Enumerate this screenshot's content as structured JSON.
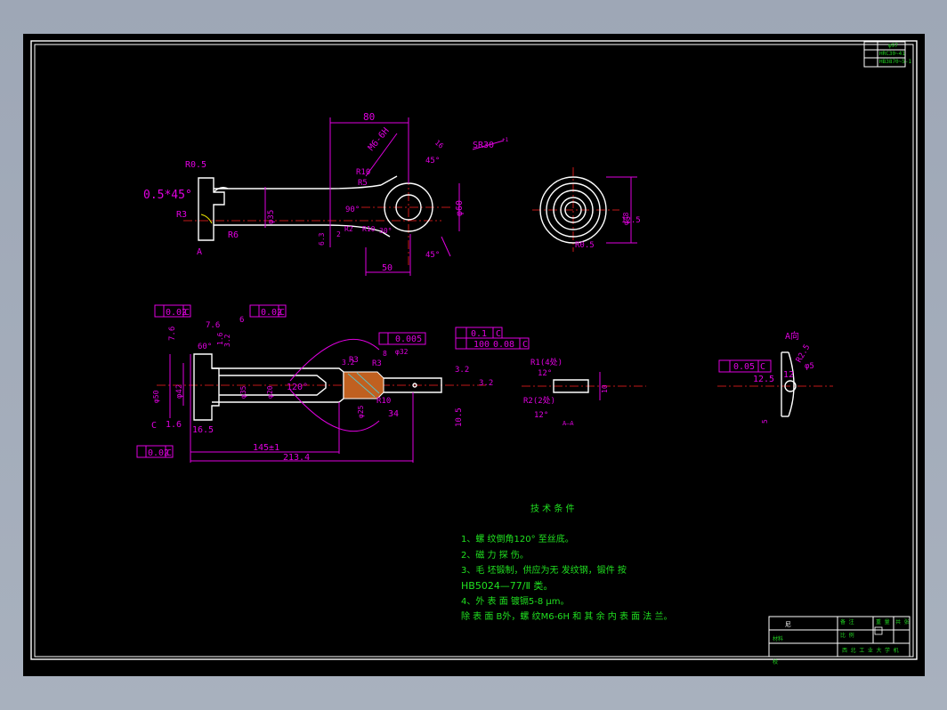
{
  "drawing": {
    "top_view": {
      "dims": [
        "80",
        "M6-6H",
        "SR30",
        "+1",
        "R0.5",
        "0.5*45°",
        "R3",
        "R6",
        "A",
        "R10",
        "R5",
        "90°",
        "R10",
        "2",
        "6.3",
        "R2",
        "30°",
        "50",
        "45°",
        "45°",
        "16",
        "φ60",
        "φ35"
      ]
    },
    "side_view": {
      "dims": [
        "φ48",
        "12.5",
        "R0.5"
      ]
    },
    "section_view": {
      "dims": [
        "0.02",
        "C",
        "7.6",
        "6",
        "0.02",
        "C",
        "7.6",
        "60°",
        "1.6",
        "3.2",
        "φ50",
        "φ42",
        "φ35",
        "φ20",
        "120°",
        "3.2",
        "R3",
        "R3",
        "8",
        "φ25",
        "R10",
        "34",
        "φ32",
        "0.005",
        "0.1",
        "C",
        "100",
        "0.08",
        "C",
        "3.2",
        "10.5",
        "3.2",
        "1.6",
        "16.5",
        "145±1",
        "213.4",
        "0.02",
        "C",
        "C"
      ]
    },
    "detail_1": {
      "dims": [
        "R1(4处)",
        "12°",
        "R2(2处)",
        "12°",
        "A—A",
        "10"
      ]
    },
    "detail_a": {
      "title": "A向",
      "dims": [
        "0.05",
        "C",
        "12.5",
        "12",
        "R2.5",
        "φ5",
        "5"
      ]
    },
    "notes": {
      "title": "技 术 条 件",
      "lines": [
        "1、螺 纹倒角120° 至丝底。",
        "2、磁 力 探 伤。",
        "3、毛 坯锻制，供应为无 发纹钢，锻件 按",
        "HB5024—77/Ⅱ 类。",
        "4、外 表 面 镀镉5-8  μm。",
        "除 表 面 B外，螺 纹M6-6H   和 其 余 内 表 面 法 兰。"
      ]
    },
    "title_block": {
      "name": "尼",
      "school": "西 北 工 业 大 学 机",
      "misc": [
        "校",
        "材料",
        "备 注",
        "重 量",
        "比 例",
        "共 张"
      ]
    },
    "corner_table": [
      "φ97",
      "HRC30~41",
      "HB3870~5-1"
    ]
  }
}
